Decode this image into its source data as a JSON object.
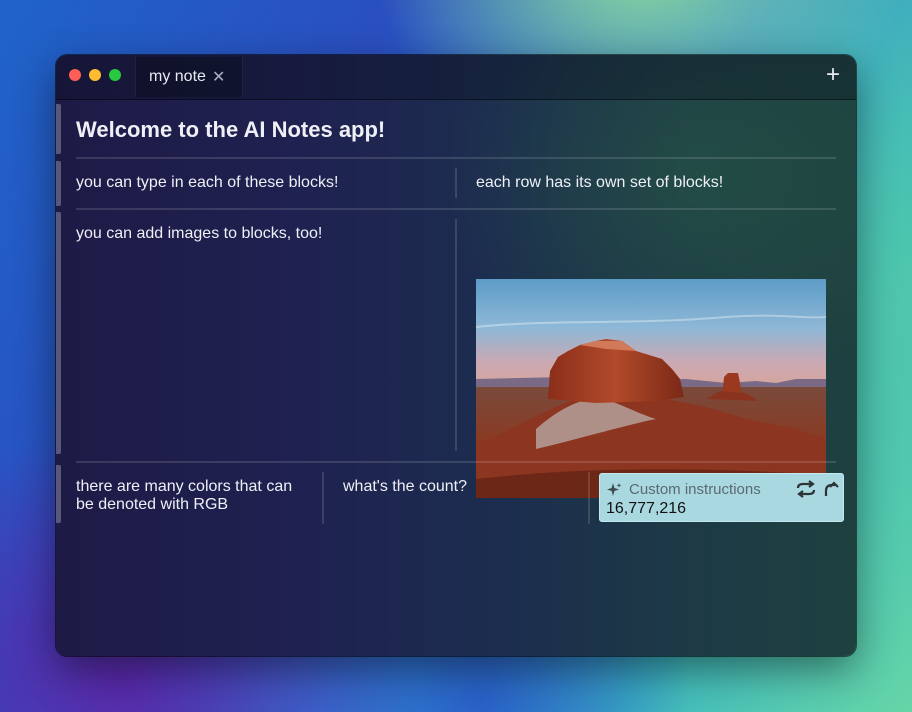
{
  "window": {
    "tab_title": "my note",
    "tab_close_glyph": "✕",
    "new_tab_glyph": "+"
  },
  "note": {
    "heading": "Welcome to the AI Notes app!",
    "rows": [
      {
        "blocks": [
          "you can type in each of these blocks!",
          "each row has its own set of blocks!"
        ]
      },
      {
        "blocks": [
          "you can add images to blocks, too!"
        ],
        "image": "desert-butte-photo"
      },
      {
        "blocks": [
          "there are many colors that can be denoted with RGB",
          "what's the count?"
        ]
      }
    ],
    "ai_block": {
      "placeholder": "Custom instructions",
      "value": "16,777,216",
      "icons": [
        "sparkle-icon",
        "regenerate-icon",
        "send-icon"
      ]
    }
  },
  "colors": {
    "ai_block_bg": "#a9d8e0",
    "close": "#ff5f57",
    "minimize": "#febc2e",
    "zoom": "#28c840"
  }
}
